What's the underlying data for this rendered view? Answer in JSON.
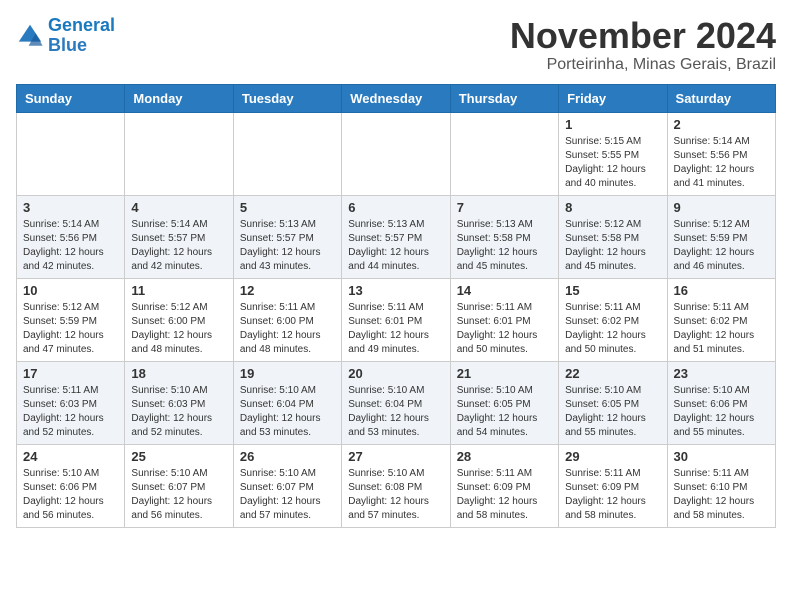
{
  "header": {
    "logo_line1": "General",
    "logo_line2": "Blue",
    "month_title": "November 2024",
    "subtitle": "Porteirinha, Minas Gerais, Brazil"
  },
  "weekdays": [
    "Sunday",
    "Monday",
    "Tuesday",
    "Wednesday",
    "Thursday",
    "Friday",
    "Saturday"
  ],
  "weeks": [
    [
      {
        "day": "",
        "info": ""
      },
      {
        "day": "",
        "info": ""
      },
      {
        "day": "",
        "info": ""
      },
      {
        "day": "",
        "info": ""
      },
      {
        "day": "",
        "info": ""
      },
      {
        "day": "1",
        "info": "Sunrise: 5:15 AM\nSunset: 5:55 PM\nDaylight: 12 hours\nand 40 minutes."
      },
      {
        "day": "2",
        "info": "Sunrise: 5:14 AM\nSunset: 5:56 PM\nDaylight: 12 hours\nand 41 minutes."
      }
    ],
    [
      {
        "day": "3",
        "info": "Sunrise: 5:14 AM\nSunset: 5:56 PM\nDaylight: 12 hours\nand 42 minutes."
      },
      {
        "day": "4",
        "info": "Sunrise: 5:14 AM\nSunset: 5:57 PM\nDaylight: 12 hours\nand 42 minutes."
      },
      {
        "day": "5",
        "info": "Sunrise: 5:13 AM\nSunset: 5:57 PM\nDaylight: 12 hours\nand 43 minutes."
      },
      {
        "day": "6",
        "info": "Sunrise: 5:13 AM\nSunset: 5:57 PM\nDaylight: 12 hours\nand 44 minutes."
      },
      {
        "day": "7",
        "info": "Sunrise: 5:13 AM\nSunset: 5:58 PM\nDaylight: 12 hours\nand 45 minutes."
      },
      {
        "day": "8",
        "info": "Sunrise: 5:12 AM\nSunset: 5:58 PM\nDaylight: 12 hours\nand 45 minutes."
      },
      {
        "day": "9",
        "info": "Sunrise: 5:12 AM\nSunset: 5:59 PM\nDaylight: 12 hours\nand 46 minutes."
      }
    ],
    [
      {
        "day": "10",
        "info": "Sunrise: 5:12 AM\nSunset: 5:59 PM\nDaylight: 12 hours\nand 47 minutes."
      },
      {
        "day": "11",
        "info": "Sunrise: 5:12 AM\nSunset: 6:00 PM\nDaylight: 12 hours\nand 48 minutes."
      },
      {
        "day": "12",
        "info": "Sunrise: 5:11 AM\nSunset: 6:00 PM\nDaylight: 12 hours\nand 48 minutes."
      },
      {
        "day": "13",
        "info": "Sunrise: 5:11 AM\nSunset: 6:01 PM\nDaylight: 12 hours\nand 49 minutes."
      },
      {
        "day": "14",
        "info": "Sunrise: 5:11 AM\nSunset: 6:01 PM\nDaylight: 12 hours\nand 50 minutes."
      },
      {
        "day": "15",
        "info": "Sunrise: 5:11 AM\nSunset: 6:02 PM\nDaylight: 12 hours\nand 50 minutes."
      },
      {
        "day": "16",
        "info": "Sunrise: 5:11 AM\nSunset: 6:02 PM\nDaylight: 12 hours\nand 51 minutes."
      }
    ],
    [
      {
        "day": "17",
        "info": "Sunrise: 5:11 AM\nSunset: 6:03 PM\nDaylight: 12 hours\nand 52 minutes."
      },
      {
        "day": "18",
        "info": "Sunrise: 5:10 AM\nSunset: 6:03 PM\nDaylight: 12 hours\nand 52 minutes."
      },
      {
        "day": "19",
        "info": "Sunrise: 5:10 AM\nSunset: 6:04 PM\nDaylight: 12 hours\nand 53 minutes."
      },
      {
        "day": "20",
        "info": "Sunrise: 5:10 AM\nSunset: 6:04 PM\nDaylight: 12 hours\nand 53 minutes."
      },
      {
        "day": "21",
        "info": "Sunrise: 5:10 AM\nSunset: 6:05 PM\nDaylight: 12 hours\nand 54 minutes."
      },
      {
        "day": "22",
        "info": "Sunrise: 5:10 AM\nSunset: 6:05 PM\nDaylight: 12 hours\nand 55 minutes."
      },
      {
        "day": "23",
        "info": "Sunrise: 5:10 AM\nSunset: 6:06 PM\nDaylight: 12 hours\nand 55 minutes."
      }
    ],
    [
      {
        "day": "24",
        "info": "Sunrise: 5:10 AM\nSunset: 6:06 PM\nDaylight: 12 hours\nand 56 minutes."
      },
      {
        "day": "25",
        "info": "Sunrise: 5:10 AM\nSunset: 6:07 PM\nDaylight: 12 hours\nand 56 minutes."
      },
      {
        "day": "26",
        "info": "Sunrise: 5:10 AM\nSunset: 6:07 PM\nDaylight: 12 hours\nand 57 minutes."
      },
      {
        "day": "27",
        "info": "Sunrise: 5:10 AM\nSunset: 6:08 PM\nDaylight: 12 hours\nand 57 minutes."
      },
      {
        "day": "28",
        "info": "Sunrise: 5:11 AM\nSunset: 6:09 PM\nDaylight: 12 hours\nand 58 minutes."
      },
      {
        "day": "29",
        "info": "Sunrise: 5:11 AM\nSunset: 6:09 PM\nDaylight: 12 hours\nand 58 minutes."
      },
      {
        "day": "30",
        "info": "Sunrise: 5:11 AM\nSunset: 6:10 PM\nDaylight: 12 hours\nand 58 minutes."
      }
    ]
  ]
}
